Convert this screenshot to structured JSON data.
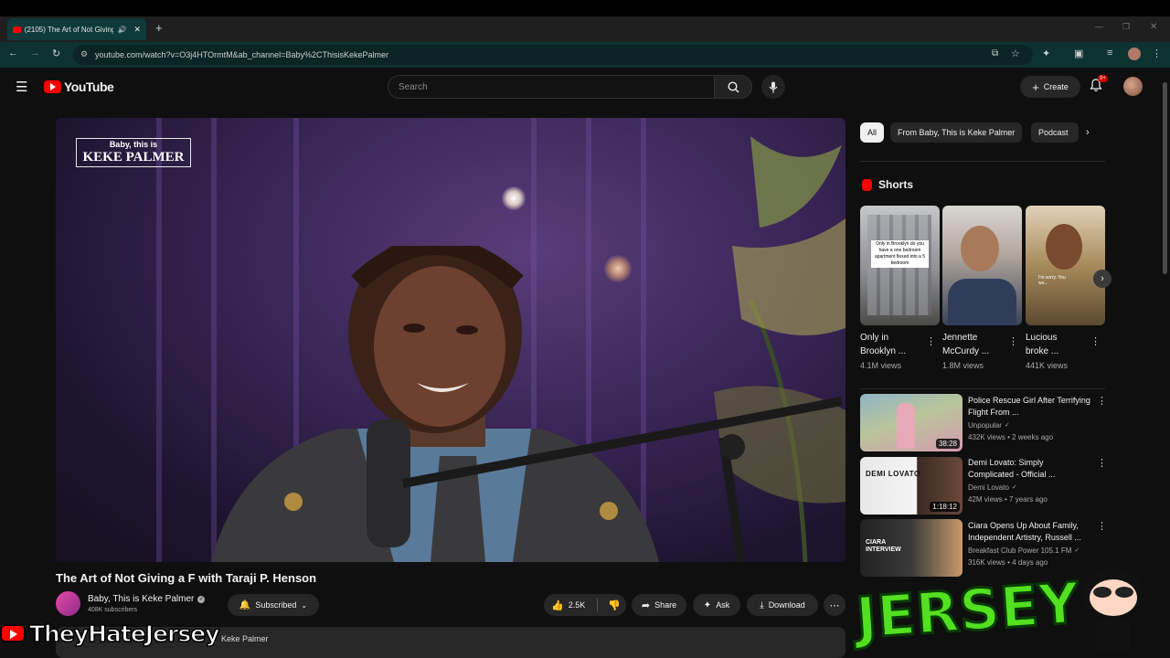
{
  "browser": {
    "tab_title": "(2105) The Art of Not Giving",
    "url": "youtube.com/watch?v=O3j4HTOrmtM&ab_channel=Baby%2CThisisKekePalmer"
  },
  "header": {
    "logo_text": "YouTube",
    "search_placeholder": "Search",
    "create_label": "Create",
    "notification_count": "9+"
  },
  "video": {
    "watermark_line1": "Baby, this is",
    "watermark_line2": "KEKE PALMER",
    "title": "The Art of Not Giving a F with Taraji P. Henson",
    "channel_name": "Baby, This is Keke Palmer",
    "subscribers": "408K subscribers",
    "subscribed_label": "Subscribed",
    "likes": "2.5K",
    "share_label": "Share",
    "ask_label": "Ask",
    "download_label": "Download",
    "description_preview": "Keke Palmer"
  },
  "sidebar": {
    "chips": [
      "All",
      "From Baby, This is Keke Palmer",
      "Podcast"
    ],
    "shorts_heading": "Shorts",
    "shorts": [
      {
        "title_line1": "Only in",
        "title_line2": "Brooklyn ...",
        "views": "4.1M views",
        "thumb_text": "Only in Brooklyn do you have a one bedroom apartment flexed into a 5 bedroom"
      },
      {
        "title_line1": "Jennette",
        "title_line2": "McCurdy ...",
        "views": "1.8M views",
        "thumb_text": ""
      },
      {
        "title_line1": "Lucious",
        "title_line2": "broke ...",
        "views": "441K views",
        "thumb_text": "I'm sorry. You wo..."
      }
    ],
    "recommendations": [
      {
        "title": "Police Rescue Girl After Terrifying Flight From ...",
        "channel": "Unpopular",
        "meta": "432K views • 2 weeks ago",
        "duration": "38:28",
        "thumb_text": ""
      },
      {
        "title": "Demi Lovato: Simply Complicated - Official ...",
        "channel": "Demi Lovato",
        "meta": "42M views • 7 years ago",
        "duration": "1:18:12",
        "thumb_text": "DEMI LOVATO"
      },
      {
        "title": "Ciara Opens Up About Family, Independent Artistry, Russell ...",
        "channel": "Breakfast Club Power 105.1 FM",
        "meta": "316K views • 4 days ago",
        "duration": "",
        "thumb_text": "CIARA INTERVIEW"
      }
    ]
  },
  "overlays": {
    "bottom_left_text": "TheyHateJersey",
    "bottom_right_text": "JERSEY"
  },
  "colors": {
    "background": "#0f0f0f",
    "accent_red": "#ff0000",
    "chip_active": "#f1f1f1",
    "jersey_green": "#52e021"
  }
}
